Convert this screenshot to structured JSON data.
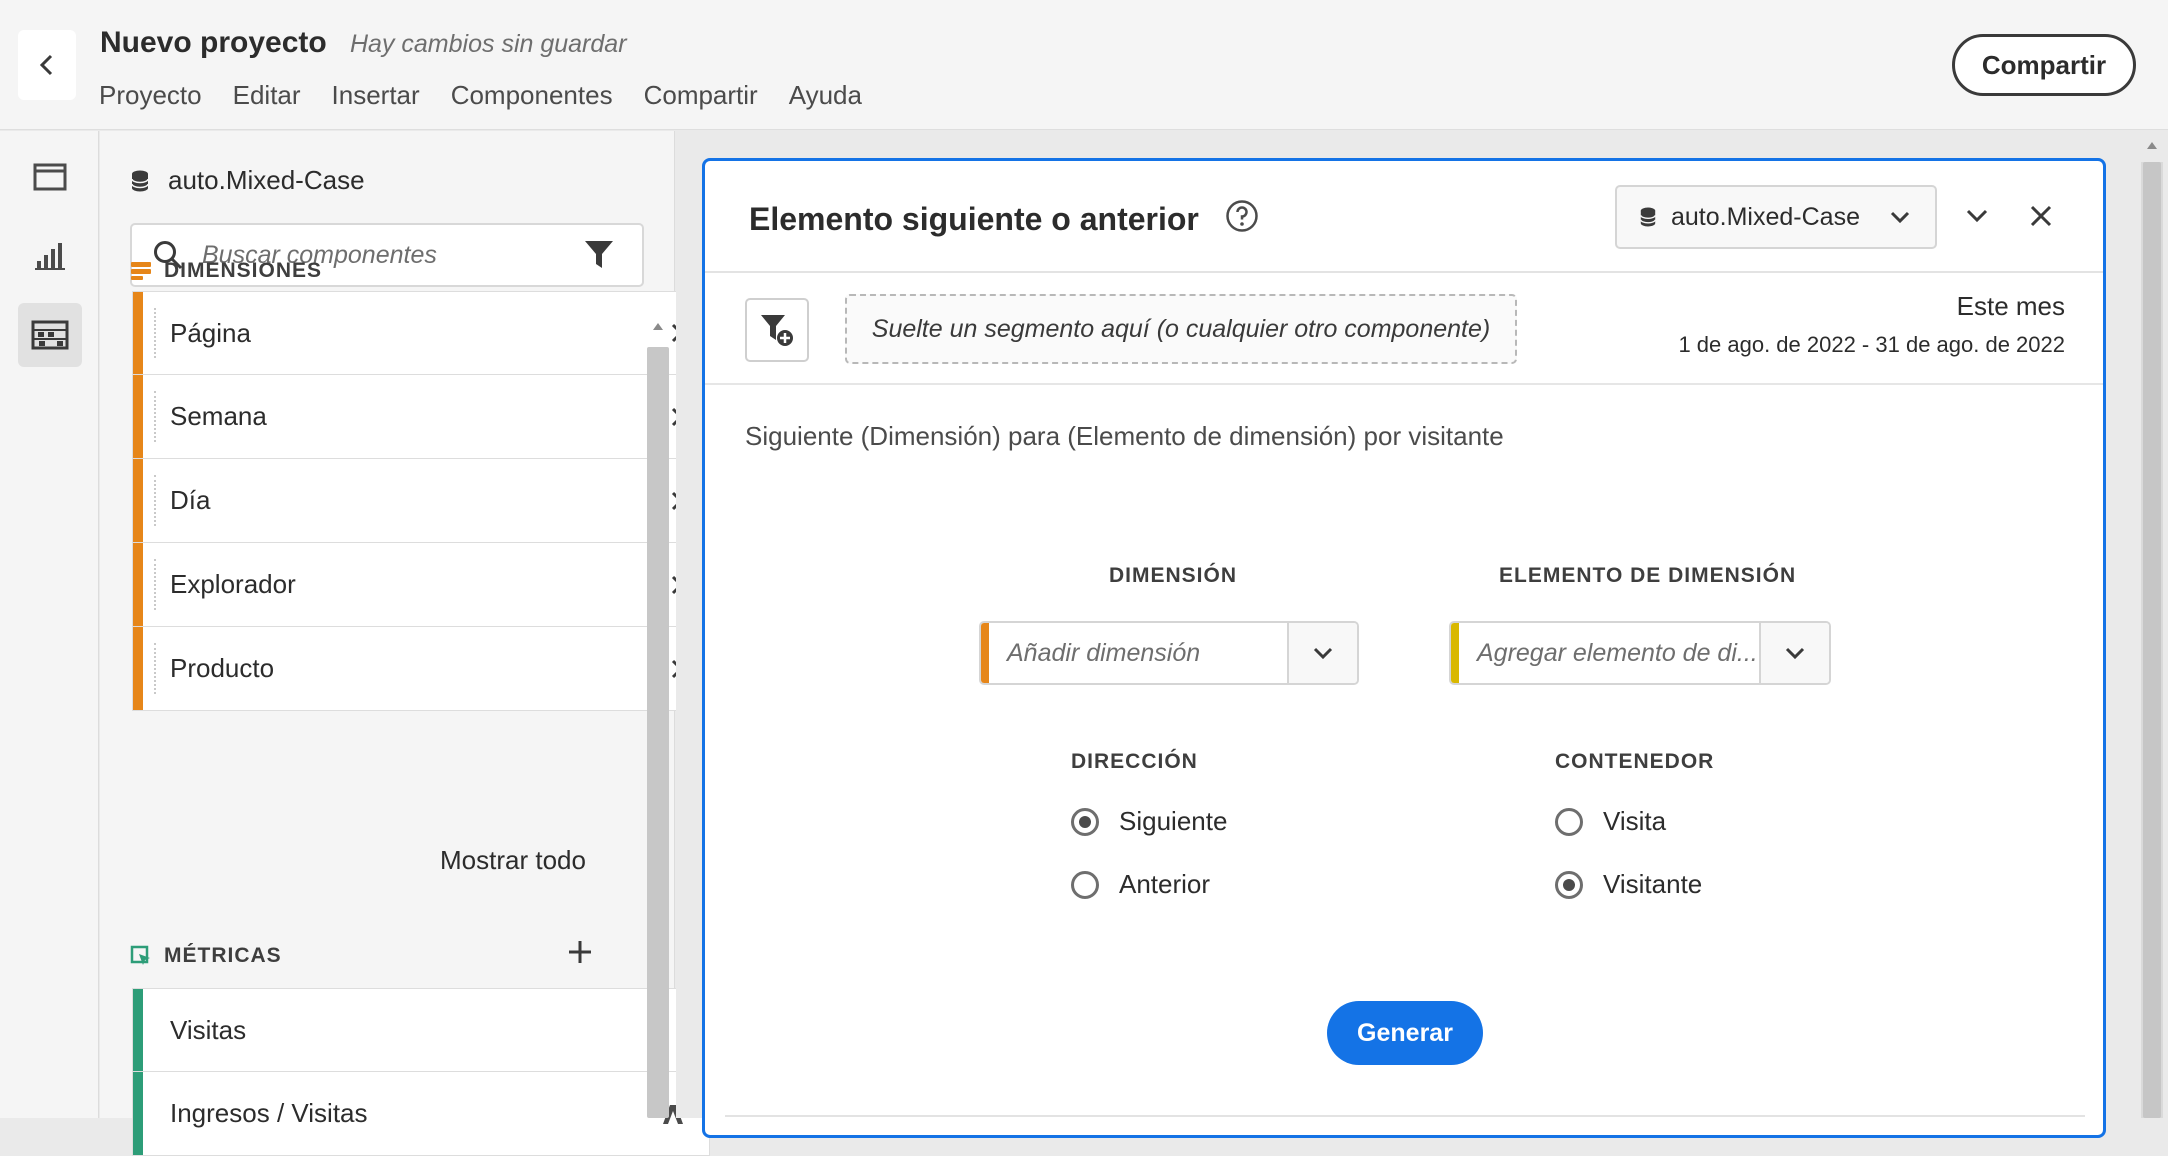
{
  "header": {
    "project_title": "Nuevo proyecto",
    "unsaved_status": "Hay cambios sin guardar",
    "menu": [
      "Proyecto",
      "Editar",
      "Insertar",
      "Componentes",
      "Compartir",
      "Ayuda"
    ],
    "share_label": "Compartir"
  },
  "rail": {
    "items": [
      {
        "icon": "panel-icon",
        "active": false
      },
      {
        "icon": "visualizations-icon",
        "active": false
      },
      {
        "icon": "components-icon",
        "active": true
      }
    ]
  },
  "components_panel": {
    "data_view": "auto.Mixed-Case",
    "search_placeholder": "Buscar componentes",
    "dimensions_heading": "DIMENSIONES",
    "dimensions": [
      "Página",
      "Semana",
      "Día",
      "Explorador",
      "Producto"
    ],
    "show_all": "Mostrar todo",
    "metrics_heading": "MÉTRICAS",
    "metrics": [
      "Visitas",
      "Ingresos / Visitas"
    ]
  },
  "card": {
    "title": "Elemento siguiente o anterior",
    "data_view": "auto.Mixed-Case",
    "segment_drop": "Suelte un segmento aquí (o cualquier otro componente)",
    "date_label": "Este mes",
    "date_range": "1 de ago. de 2022 - 31 de ago. de 2022",
    "description": "Siguiente (Dimensión) para (Elemento de dimensión) por visitante",
    "dimension_label": "DIMENSIÓN",
    "dimension_placeholder": "Añadir dimensión",
    "dimension_item_label": "ELEMENTO DE DIMENSIÓN",
    "dimension_item_placeholder": "Agregar elemento de di...",
    "direction_label": "DIRECCIÓN",
    "direction_options": [
      "Siguiente",
      "Anterior"
    ],
    "direction_selected": "Siguiente",
    "container_label": "CONTENEDOR",
    "container_options": [
      "Visita",
      "Visitante"
    ],
    "container_selected": "Visitante",
    "generate_label": "Generar"
  },
  "colors": {
    "accent_blue": "#1473e6",
    "dimension_orange": "#e68619",
    "metric_green": "#2d9d78",
    "dimension_item_yellow": "#d9b800"
  }
}
